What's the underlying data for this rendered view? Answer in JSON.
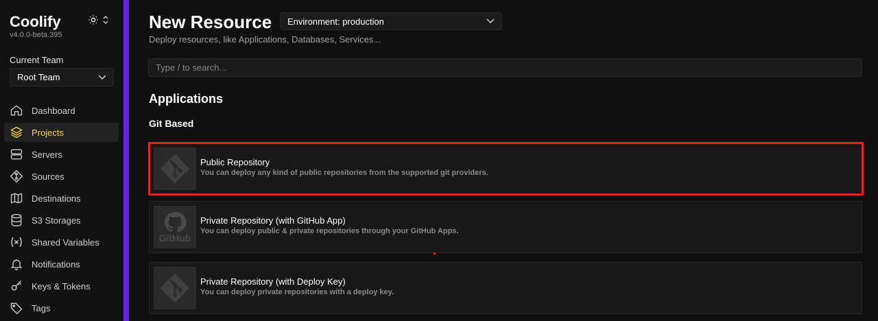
{
  "app": {
    "name": "Coolify",
    "version": "v4.0.0-beta.395"
  },
  "team": {
    "label": "Current Team",
    "selected": "Root Team"
  },
  "nav": [
    {
      "label": "Dashboard",
      "icon": "home-icon"
    },
    {
      "label": "Projects",
      "icon": "layers-icon",
      "active": true
    },
    {
      "label": "Servers",
      "icon": "server-icon"
    },
    {
      "label": "Sources",
      "icon": "git-icon"
    },
    {
      "label": "Destinations",
      "icon": "map-icon"
    },
    {
      "label": "S3 Storages",
      "icon": "database-icon"
    },
    {
      "label": "Shared Variables",
      "icon": "variable-icon"
    },
    {
      "label": "Notifications",
      "icon": "bell-icon"
    },
    {
      "label": "Keys & Tokens",
      "icon": "key-icon"
    },
    {
      "label": "Tags",
      "icon": "tag-icon"
    }
  ],
  "page": {
    "title": "New Resource",
    "environment": "Environment: production",
    "subtitle": "Deploy resources, like Applications, Databases, Services...",
    "search_placeholder": "Type / to search...",
    "section": "Applications",
    "subsection": "Git Based"
  },
  "cards": [
    {
      "title": "Public Repository",
      "desc": "You can deploy any kind of public repositories from the supported git providers.",
      "logo": "git-logo-icon",
      "highlighted": true
    },
    {
      "title": "Private Repository (with GitHub App)",
      "desc": "You can deploy public & private repositories through your GitHub Apps.",
      "logo": "github-logo-icon",
      "logo_text": "GitHub"
    },
    {
      "title": "Private Repository (with Deploy Key)",
      "desc": "You can deploy private repositories with a deploy key.",
      "logo": "git-logo-icon"
    }
  ],
  "colors": {
    "accent": "#6b21e8",
    "active_nav": "#fcd34d",
    "highlight": "#dc2626"
  }
}
